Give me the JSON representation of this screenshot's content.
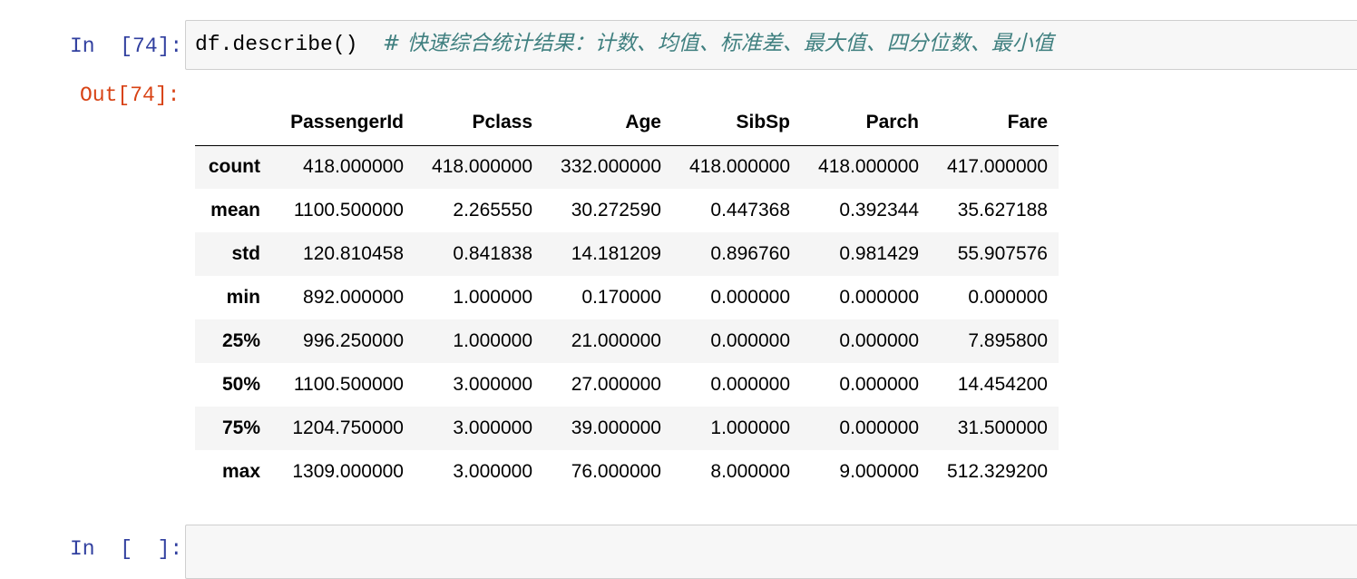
{
  "cells": [
    {
      "prompt": "In  [74]:",
      "code": "df.describe()",
      "comment": "# 快速综合统计结果：计数、均值、标准差、最大值、四分位数、最小值",
      "output_prompt": "Out[74]:"
    },
    {
      "prompt": "In  [  ]:"
    }
  ],
  "table": {
    "columns": [
      "PassengerId",
      "Pclass",
      "Age",
      "SibSp",
      "Parch",
      "Fare"
    ],
    "rows": [
      {
        "label": "count",
        "values": [
          "418.000000",
          "418.000000",
          "332.000000",
          "418.000000",
          "418.000000",
          "417.000000"
        ]
      },
      {
        "label": "mean",
        "values": [
          "1100.500000",
          "2.265550",
          "30.272590",
          "0.447368",
          "0.392344",
          "35.627188"
        ]
      },
      {
        "label": "std",
        "values": [
          "120.810458",
          "0.841838",
          "14.181209",
          "0.896760",
          "0.981429",
          "55.907576"
        ]
      },
      {
        "label": "min",
        "values": [
          "892.000000",
          "1.000000",
          "0.170000",
          "0.000000",
          "0.000000",
          "0.000000"
        ]
      },
      {
        "label": "25%",
        "values": [
          "996.250000",
          "1.000000",
          "21.000000",
          "0.000000",
          "0.000000",
          "7.895800"
        ]
      },
      {
        "label": "50%",
        "values": [
          "1100.500000",
          "3.000000",
          "27.000000",
          "0.000000",
          "0.000000",
          "14.454200"
        ]
      },
      {
        "label": "75%",
        "values": [
          "1204.750000",
          "3.000000",
          "39.000000",
          "1.000000",
          "0.000000",
          "31.500000"
        ]
      },
      {
        "label": "max",
        "values": [
          "1309.000000",
          "3.000000",
          "76.000000",
          "8.000000",
          "9.000000",
          "512.329200"
        ]
      }
    ]
  }
}
